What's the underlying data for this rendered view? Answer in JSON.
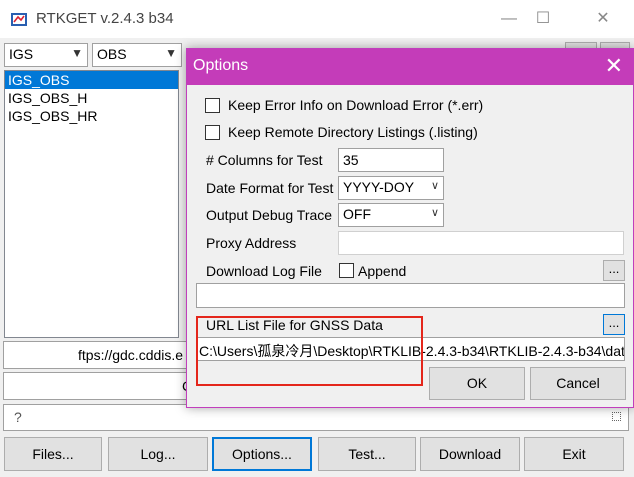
{
  "window": {
    "title": "RTKGET v.2.4.3 b34",
    "controls": [
      "—",
      "☐",
      "✕"
    ]
  },
  "filters": {
    "source": "IGS",
    "type": "OBS"
  },
  "list": {
    "items": [
      "IGS_OBS",
      "IGS_OBS_H",
      "IGS_OBS_HR"
    ]
  },
  "url_field": "ftps://gdc.cddis.e",
  "url_field2": "C",
  "status_field": "?",
  "dialog": {
    "title": "Options",
    "close": "✕",
    "keep_error_label": "Keep Error Info on Download Error (*.err)",
    "keep_remote_label": "Keep Remote Directory Listings (.listing)",
    "columns_label": "# Columns for Test",
    "columns_value": "35",
    "date_format_label": "Date Format for Test",
    "date_format_value": "YYYY-DOY",
    "debug_label": "Output Debug Trace",
    "debug_value": "OFF",
    "proxy_label": "Proxy Address",
    "proxy_value": "",
    "log_label": "Download Log File",
    "append_label": "Append",
    "browse_label": "...",
    "log_path": "",
    "url_list_label": "URL List File for GNSS Data",
    "url_list_path": "C:\\Users\\孤泉冷月\\Desktop\\RTKLIB-2.4.3-b34\\RTKLIB-2.4.3-b34\\dat",
    "ok_label": "OK",
    "cancel_label": "Cancel"
  },
  "bottom_buttons": {
    "files": "Files...",
    "log": "Log...",
    "options": "Options...",
    "test": "Test...",
    "download": "Download",
    "exit": "Exit"
  },
  "colors": {
    "dialog_titlebar": "#c43cb9",
    "selection": "#0078d7",
    "annotation": "#e4261b"
  }
}
